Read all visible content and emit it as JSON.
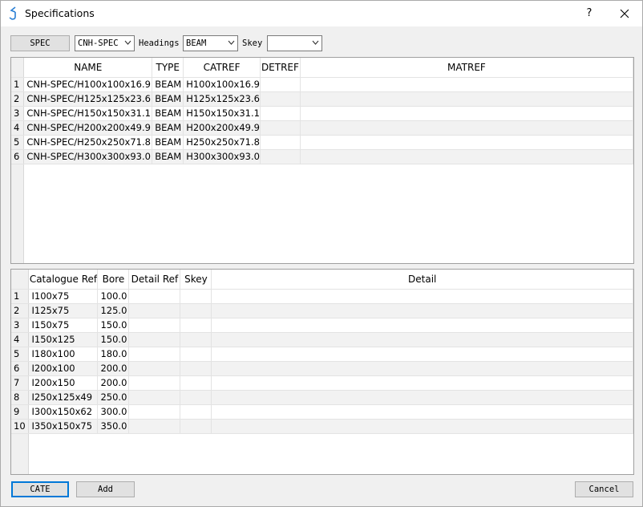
{
  "window": {
    "title": "Specifications",
    "help_label": "?"
  },
  "toolbar": {
    "spec_button": "SPEC",
    "spec_combo_value": "CNH-SPEC",
    "headings_label": "Headings",
    "headings_combo_value": "BEAM",
    "skey_label": "Skey",
    "skey_combo_value": ""
  },
  "spec_table": {
    "columns": [
      "NAME",
      "TYPE",
      "CATREF",
      "DETREF",
      "MATREF"
    ],
    "rows": [
      {
        "num": "1",
        "name": "CNH-SPEC/H100x100x16.9",
        "type": "BEAM",
        "catref": "H100x100x16.9",
        "detref": "",
        "matref": ""
      },
      {
        "num": "2",
        "name": "CNH-SPEC/H125x125x23.6",
        "type": "BEAM",
        "catref": "H125x125x23.6",
        "detref": "",
        "matref": ""
      },
      {
        "num": "3",
        "name": "CNH-SPEC/H150x150x31.1",
        "type": "BEAM",
        "catref": "H150x150x31.1",
        "detref": "",
        "matref": ""
      },
      {
        "num": "4",
        "name": "CNH-SPEC/H200x200x49.9",
        "type": "BEAM",
        "catref": "H200x200x49.9",
        "detref": "",
        "matref": ""
      },
      {
        "num": "5",
        "name": "CNH-SPEC/H250x250x71.8",
        "type": "BEAM",
        "catref": "H250x250x71.8",
        "detref": "",
        "matref": ""
      },
      {
        "num": "6",
        "name": "CNH-SPEC/H300x300x93.0",
        "type": "BEAM",
        "catref": "H300x300x93.0",
        "detref": "",
        "matref": ""
      }
    ]
  },
  "cat_table": {
    "columns": [
      "Catalogue Ref",
      "Bore",
      "Detail Ref",
      "Skey",
      "Detail"
    ],
    "rows": [
      {
        "num": "1",
        "catref": "I100x75",
        "bore": "100.0",
        "detref": "",
        "skey": "",
        "detail": ""
      },
      {
        "num": "2",
        "catref": "I125x75",
        "bore": "125.0",
        "detref": "",
        "skey": "",
        "detail": ""
      },
      {
        "num": "3",
        "catref": "I150x75",
        "bore": "150.0",
        "detref": "",
        "skey": "",
        "detail": ""
      },
      {
        "num": "4",
        "catref": "I150x125",
        "bore": "150.0",
        "detref": "",
        "skey": "",
        "detail": ""
      },
      {
        "num": "5",
        "catref": "I180x100",
        "bore": "180.0",
        "detref": "",
        "skey": "",
        "detail": ""
      },
      {
        "num": "6",
        "catref": "I200x100",
        "bore": "200.0",
        "detref": "",
        "skey": "",
        "detail": ""
      },
      {
        "num": "7",
        "catref": "I200x150",
        "bore": "200.0",
        "detref": "",
        "skey": "",
        "detail": ""
      },
      {
        "num": "8",
        "catref": "I250x125x49",
        "bore": "250.0",
        "detref": "",
        "skey": "",
        "detail": ""
      },
      {
        "num": "9",
        "catref": "I300x150x62",
        "bore": "300.0",
        "detref": "",
        "skey": "",
        "detail": ""
      },
      {
        "num": "10",
        "catref": "I350x150x75",
        "bore": "350.0",
        "detref": "",
        "skey": "",
        "detail": ""
      }
    ]
  },
  "buttons": {
    "cate": "CATE",
    "add": "Add",
    "cancel": "Cancel"
  },
  "colors": {
    "accent": "#0078d7",
    "alt_row": "#f2f2f2"
  }
}
